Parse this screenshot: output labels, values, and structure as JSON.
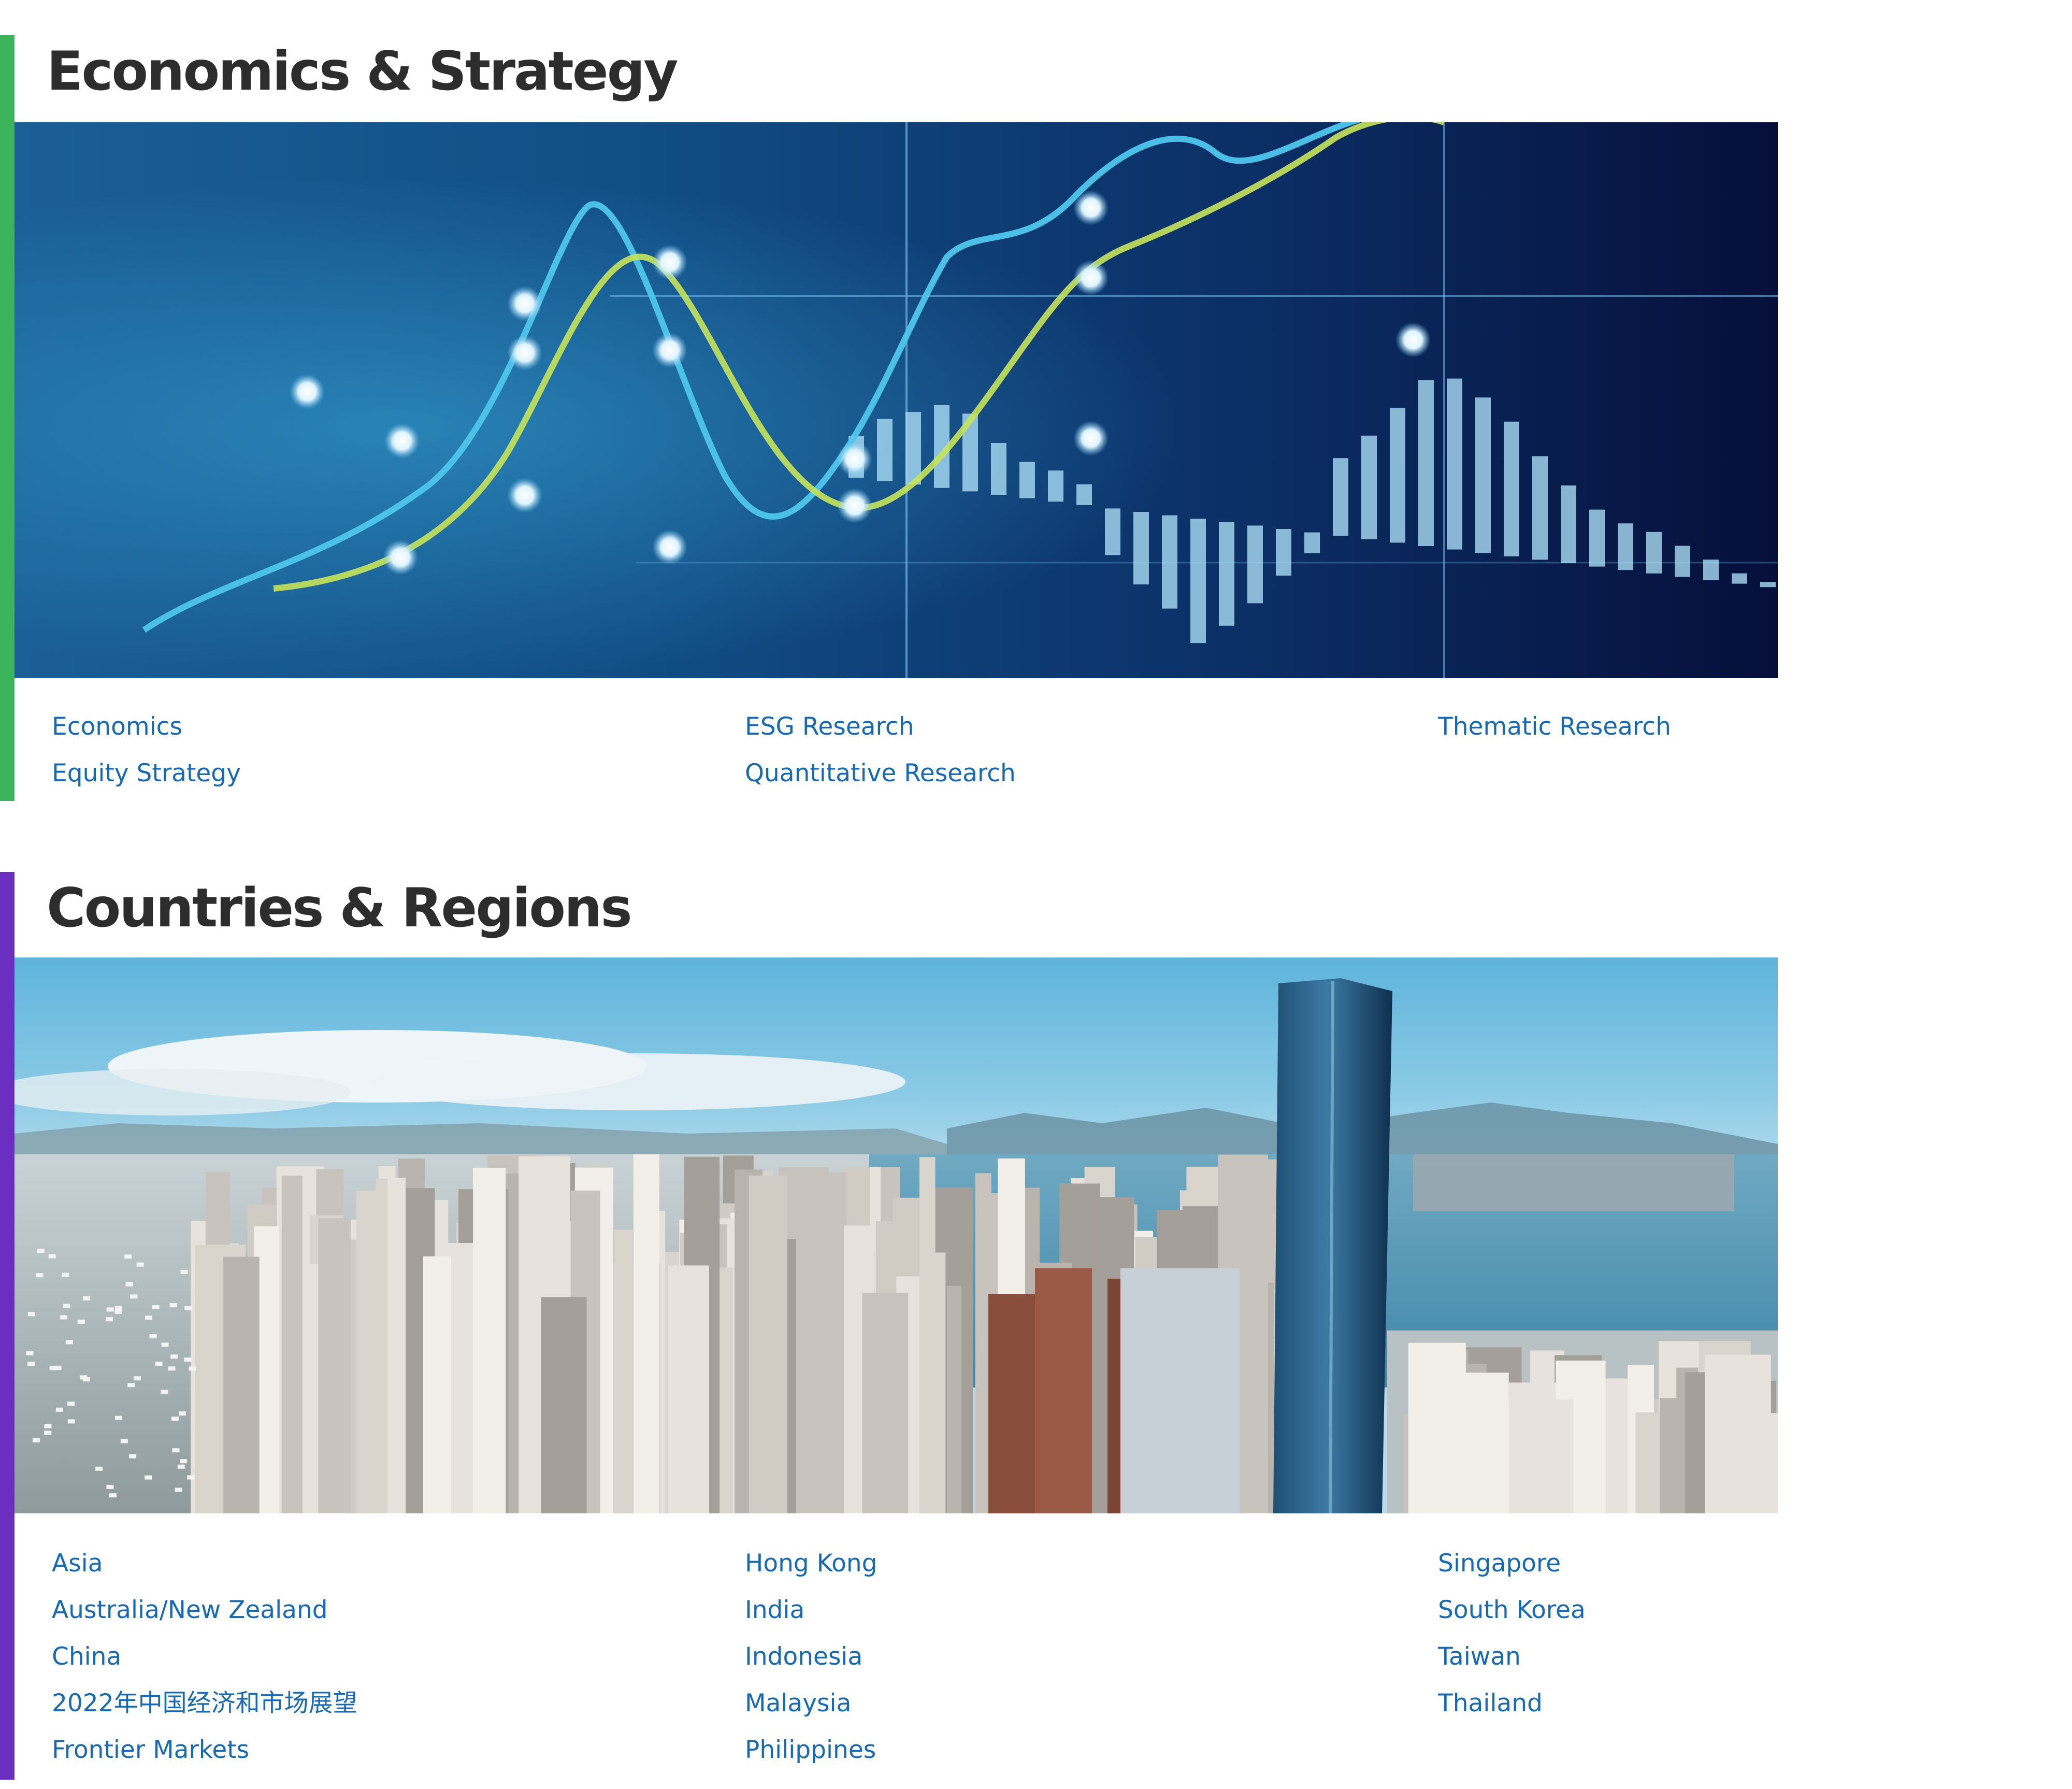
{
  "colors": {
    "econ_accent": "#3cb45c",
    "region_accent": "#6a2fc0",
    "link": "#1769b2",
    "title": "#2d2d2d"
  },
  "economics_strategy": {
    "title": "Economics & Strategy",
    "banner_image": "financial-chart-display-photo",
    "columns": [
      [
        "Economics",
        "Equity Strategy"
      ],
      [
        "ESG Research",
        "Quantitative Research"
      ],
      [
        "Thematic Research"
      ]
    ]
  },
  "countries_regions": {
    "title": "Countries & Regions",
    "banner_image": "hong-kong-skyline-photo",
    "columns": [
      [
        "Asia",
        "Australia/New Zealand",
        "China",
        "2022年中国经济和市场展望",
        "Frontier Markets"
      ],
      [
        "Hong Kong",
        "India",
        "Indonesia",
        "Malaysia",
        "Philippines"
      ],
      [
        "Singapore",
        "South Korea",
        "Taiwan",
        "Thailand"
      ]
    ]
  }
}
